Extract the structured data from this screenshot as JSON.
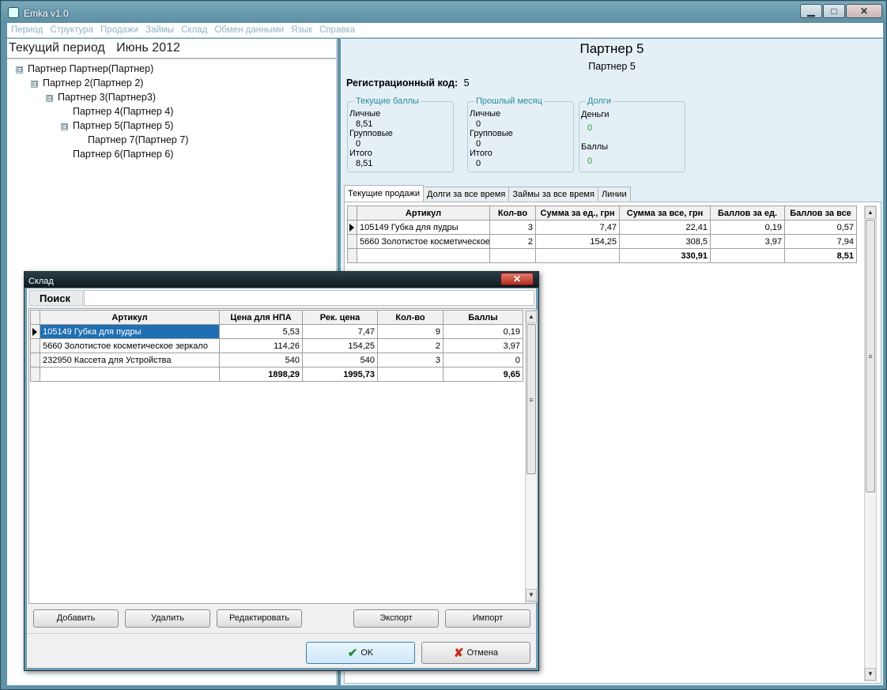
{
  "window": {
    "title": "Emka v1.0"
  },
  "menu": [
    "Период",
    "Структура",
    "Продажи",
    "Займы",
    "Склад",
    "Обмен данными",
    "Язык",
    "Справка"
  ],
  "period": {
    "label": "Текущий период",
    "value": "Июнь 2012"
  },
  "tree": [
    {
      "label": "Партнер Партнер(Партнер)",
      "toggle": "⊟"
    },
    {
      "label": "Партнер 2(Партнер 2)",
      "toggle": "⊟"
    },
    {
      "label": "Партнер 3(Партнер3)",
      "toggle": "⊟"
    },
    {
      "label": "Партнер 4(Партнер 4)",
      "toggle": ""
    },
    {
      "label": "Партнер 5(Партнер 5)",
      "toggle": "⊟"
    },
    {
      "label": "Партнер 7(Партнер 7)",
      "toggle": ""
    },
    {
      "label": "Партнер 6(Партнер 6)",
      "toggle": ""
    }
  ],
  "partner": {
    "title": "Партнер 5",
    "subtitle": "Партнер 5",
    "reg_label": "Регистрационный код:",
    "reg_value": "5"
  },
  "groups": {
    "current": {
      "legend": "Текущие баллы",
      "personal_label": "Личные",
      "personal": "8,51",
      "group_label": "Групповые",
      "group": "0",
      "total_label": "Итого",
      "total": "8,51"
    },
    "last": {
      "legend": "Прошлый месяц",
      "personal_label": "Личные",
      "personal": "0",
      "group_label": "Групповые",
      "group": "0",
      "total_label": "Итого",
      "total": "0"
    },
    "debts": {
      "legend": "Долги",
      "money_label": "Деньги",
      "money": "0",
      "points_label": "Баллы",
      "points": "0"
    }
  },
  "tabs": [
    "Текущие продажи",
    "Долги за все время",
    "Займы за все время",
    "Линии"
  ],
  "sales": {
    "headers": [
      "Артикул",
      "Кол-во",
      "Сумма за ед., грн",
      "Сумма за все, грн",
      "Баллов за ед.",
      "Баллов за все"
    ],
    "rows": [
      [
        "105149 Губка для пудры",
        "3",
        "7,47",
        "22,41",
        "0,19",
        "0,57"
      ],
      [
        "5660 Золотистое косметическое",
        "2",
        "154,25",
        "308,5",
        "3,97",
        "7,94"
      ]
    ],
    "total": [
      "",
      "",
      "",
      "330,91",
      "",
      "8,51"
    ]
  },
  "dialog": {
    "title": "Склад",
    "search_label": "Поиск",
    "search_value": "",
    "headers": [
      "Артикул",
      "Цена для НПА",
      "Рек. цена",
      "Кол-во",
      "Баллы"
    ],
    "rows": [
      [
        "105149 Губка для пудры",
        "5,53",
        "7,47",
        "9",
        "0,19"
      ],
      [
        "5660 Золотистое косметическое зеркало",
        "114,26",
        "154,25",
        "2",
        "3,97"
      ],
      [
        "232950 Кассета для Устройства",
        "540",
        "540",
        "3",
        "0"
      ]
    ],
    "total": [
      "",
      "1898,29",
      "1995,73",
      "",
      "9,65"
    ],
    "buttons": {
      "add": "Добавить",
      "delete": "Удалить",
      "edit": "Редактировать",
      "export": "Экспорт",
      "import": "Импорт",
      "ok": "OK",
      "cancel": "Отмена"
    }
  }
}
